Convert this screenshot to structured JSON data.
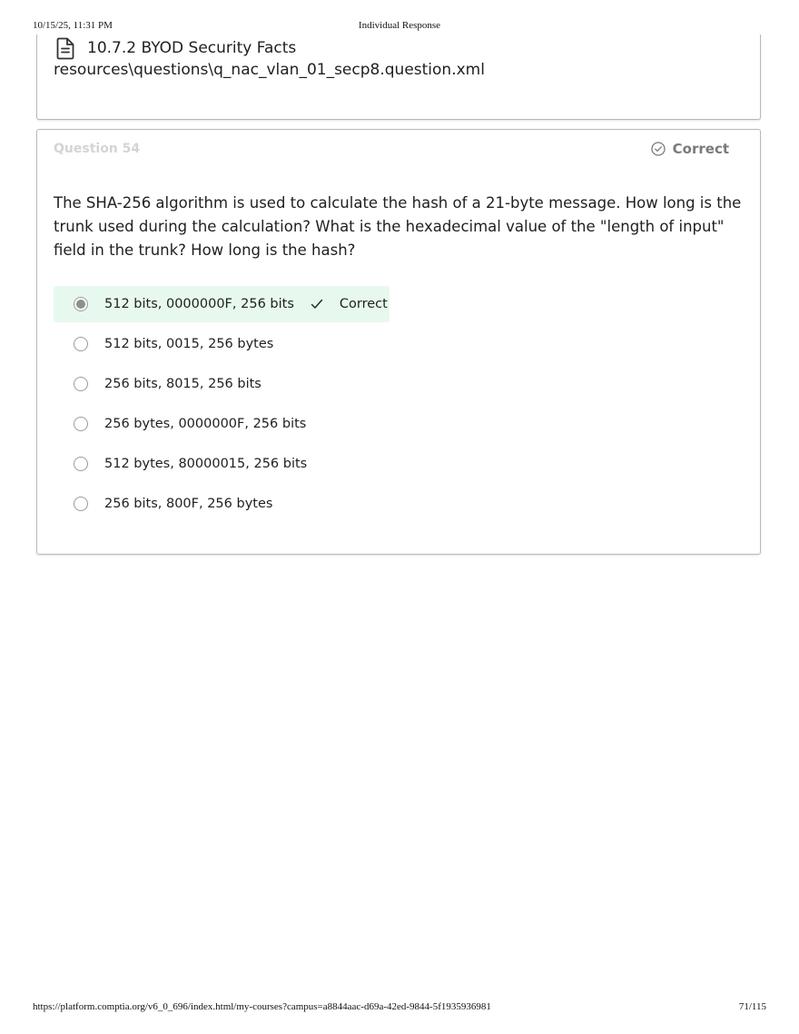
{
  "print_header": {
    "datetime": "10/15/25, 11:31 PM",
    "title": "Individual Response"
  },
  "resource": {
    "icon": "document-icon",
    "title": "10.7.2 BYOD Security Facts",
    "path": "resources\\questions\\q_nac_vlan_01_secp8.question.xml"
  },
  "question": {
    "number_label": "Question 54",
    "status_icon": "check-circle-icon",
    "status_label": "Correct",
    "text": "The SHA-256 algorithm is used to calculate the hash of a 21-byte message. How long is the trunk used during the calculation? What is the hexadecimal value of the \"length of input\" field in the trunk? How long is the hash?",
    "answers": [
      {
        "label": "512 bits, 0000000F, 256 bits",
        "selected": true,
        "feedback": "Correct"
      },
      {
        "label": "512 bits, 0015, 256 bytes",
        "selected": false
      },
      {
        "label": "256 bits, 8015, 256 bits",
        "selected": false
      },
      {
        "label": "256 bytes, 0000000F, 256 bits",
        "selected": false
      },
      {
        "label": "512 bytes, 80000015, 256 bits",
        "selected": false
      },
      {
        "label": "256 bits, 800F, 256 bytes",
        "selected": false
      }
    ]
  },
  "colors": {
    "selected_background": "#e7f9ee",
    "muted_text": "#d4d4d4",
    "status_text": "#7a7a7a"
  },
  "print_footer": {
    "url": "https://platform.comptia.org/v6_0_696/index.html/my-courses?campus=a8844aac-d69a-42ed-9844-5f1935936981",
    "page": "71/115"
  }
}
